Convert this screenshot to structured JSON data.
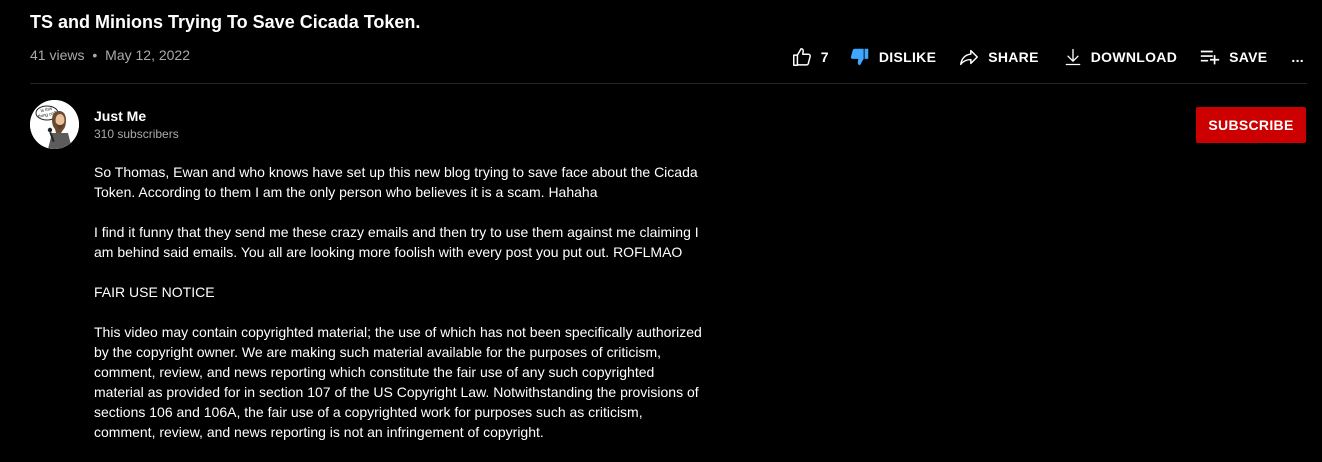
{
  "video": {
    "title": "TS and Minions Trying To Save Cicada Token.",
    "views": "41 views",
    "separator": "•",
    "date": "May 12, 2022"
  },
  "actions": {
    "like_count": "7",
    "dislike_label": "DISLIKE",
    "share_label": "SHARE",
    "download_label": "DOWNLOAD",
    "save_label": "SAVE",
    "more_label": "..."
  },
  "icons": {
    "like": "thumb-up-outline-icon",
    "dislike": "thumb-down-filled-icon",
    "share": "share-arrow-icon",
    "download": "download-icon",
    "save": "playlist-add-icon",
    "avatar": "cartoon-avatar"
  },
  "colors": {
    "background": "#000000",
    "text": "#ffffff",
    "secondary_text": "#aaaaaa",
    "subscribe_bg": "#cc0000",
    "dislike_icon": "#3ea6ff"
  },
  "channel": {
    "name": "Just Me",
    "subscribers": "310 subscribers",
    "subscribe_label": "SUBSCRIBE",
    "avatar_caption": "Is this thing on?"
  },
  "description": {
    "p1": "So Thomas, Ewan and who knows have set up this new blog trying to save face about the Cicada\nToken. According to them I am the only person who believes it is a scam. Hahaha",
    "p2": "I find it funny that they send me these crazy emails and then try to use them against me claiming I\nam behind said emails. You all are looking more foolish with every post you put out. ROFLMAO",
    "p3": "FAIR USE NOTICE",
    "p4": "This video may contain copyrighted material; the use of which has not been specifically authorized\nby the copyright owner. We are making such material available for the purposes of criticism,\ncomment, review, and news reporting which constitute the fair use of any such copyrighted\nmaterial as provided for in section 107 of the US Copyright Law. Notwithstanding the provisions of\nsections 106 and 106A, the fair use of a copyrighted work for purposes such as criticism,\ncomment, review, and news reporting is not an infringement of copyright."
  }
}
